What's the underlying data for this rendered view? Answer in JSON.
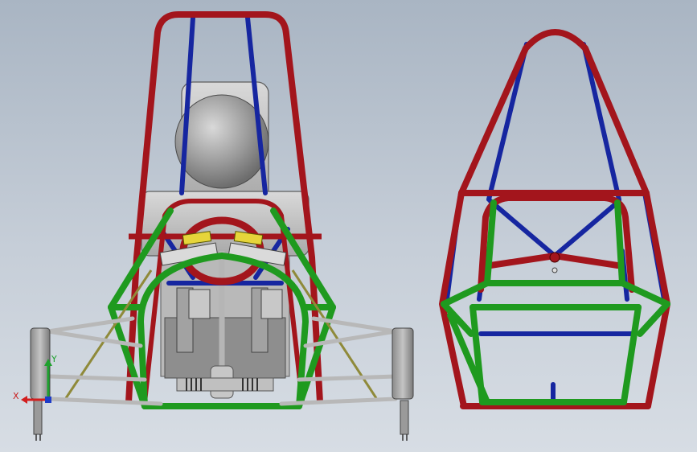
{
  "viewport": {
    "background_top": "#a9b5c3",
    "background_bottom": "#d7dde4"
  },
  "triad": {
    "x_label": "X",
    "y_label": "Y",
    "x_color": "#d21e1e",
    "y_color": "#1ea02d",
    "z_color": "#1e3cc8"
  },
  "colors": {
    "main_hoop": "#a3151c",
    "front_hoop": "#1f9a1f",
    "bracing": "#1626a0",
    "suspension": "#b8b8b8",
    "pushrod": "#8f8a3a",
    "driver_head": "#8d8d8d",
    "seat": "#c9c9c9"
  },
  "views": [
    {
      "name": "front-view"
    },
    {
      "name": "rear-view"
    }
  ]
}
